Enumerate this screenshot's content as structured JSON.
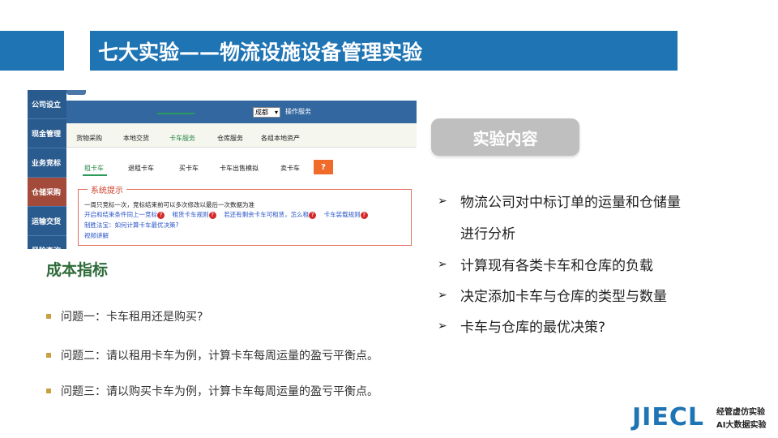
{
  "header": {
    "title": "七大实验——物流设施设备管理实验"
  },
  "screenshot": {
    "sidebar": [
      "公司设立",
      "现金管理",
      "业务竞标",
      "仓储采购",
      "运输交货",
      "风险查询"
    ],
    "city_select": "成都",
    "ops_label": "操作服务",
    "menu": [
      "货物采购",
      "本地交货",
      "卡车服务",
      "仓库服务",
      "各组本地资产"
    ],
    "sub_menu": [
      "租卡车",
      "退租卡车",
      "买卡车",
      "卡车出售模拟",
      "卖卡车"
    ],
    "help_button": "?",
    "system_title": "系统提示",
    "system_lines": {
      "line1": "一周只竞标一次，竞标结束前可以多次修改以最后一次数据为准",
      "line2_a": "开启和结束条件同上一竞标",
      "line2_b": "租赁卡车规则",
      "line2_c": "若还有剩余卡车可租赁，怎么租",
      "line2_d": "卡车装载规则",
      "line3": "制胜法宝：如何计算卡车最优决策?",
      "line4": "视频讲解"
    }
  },
  "cost": {
    "title": "成本指标",
    "questions": [
      "问题一：卡车租用还是购买?",
      "问题二：请以租用卡车为例，计算卡车每周运量的盈亏平衡点。",
      "问题三：请以购买卡车为例，计算卡车每周运量的盈亏平衡点。"
    ]
  },
  "experiment": {
    "button": "实验内容",
    "items": [
      "物流公司对中标订单的运量和仓储量",
      "进行分析",
      "计算现有各类卡车和仓库的负载",
      "决定添加卡车与仓库的类型与数量",
      "卡车与仓库的最优决策?"
    ]
  },
  "logo": {
    "text": "JIECL",
    "line1": "经管虚仿实验",
    "line2": "AI大数据实验"
  },
  "colors": {
    "primary": "#1f74b4",
    "accent_green": "#2e6b3a",
    "bullet_gold": "#c8a040"
  }
}
